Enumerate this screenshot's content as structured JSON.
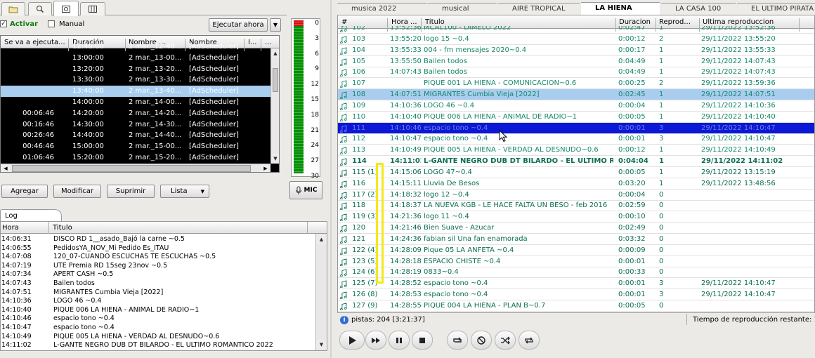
{
  "left": {
    "activar_label": "Activar",
    "manual_label": "Manual",
    "ejecutar_label": "Ejecutar ahora",
    "columns": [
      "Se va a ejecuta...",
      "Duración",
      "Nombre ...",
      "Nombre",
      "I...",
      "..."
    ],
    "rows": [
      {
        "sev": "",
        "dur": "12:40:00",
        "n1": "2 mar._12-40...",
        "n2": "[AdScheduler]"
      },
      {
        "sev": "",
        "dur": "13:00:00",
        "n1": "2 mar._13-00...",
        "n2": "[AdScheduler]"
      },
      {
        "sev": "",
        "dur": "13:20:00",
        "n1": "2 mar._13-20...",
        "n2": "[AdScheduler]"
      },
      {
        "sev": "",
        "dur": "13:30:00",
        "n1": "2 mar._13-30...",
        "n2": "[AdScheduler]"
      },
      {
        "sev": "",
        "dur": "13:40:00",
        "n1": "2 mar._13-40...",
        "n2": "[AdScheduler]",
        "sel": true
      },
      {
        "sev": "",
        "dur": "14:00:00",
        "n1": "2 mar._14-00...",
        "n2": "[AdScheduler]"
      },
      {
        "sev": "00:06:46",
        "dur": "14:20:00",
        "n1": "2 mar._14-20...",
        "n2": "[AdScheduler]"
      },
      {
        "sev": "00:16:46",
        "dur": "14:30:00",
        "n1": "2 mar._14-30...",
        "n2": "[AdScheduler]"
      },
      {
        "sev": "00:26:46",
        "dur": "14:40:00",
        "n1": "2 mar._14-40...",
        "n2": "[AdScheduler]"
      },
      {
        "sev": "00:46:46",
        "dur": "15:00:00",
        "n1": "2 mar._15-00...",
        "n2": "[AdScheduler]"
      },
      {
        "sev": "01:06:46",
        "dur": "15:20:00",
        "n1": "2 mar._15-20...",
        "n2": "[AdScheduler]"
      },
      {
        "sev": "01:16:46",
        "dur": "15:30:00",
        "n1": "2 mar._15-30...",
        "n2": "[AdScheduler]"
      }
    ],
    "buttons": {
      "agregar": "Agregar",
      "modificar": "Modificar",
      "suprimir": "Suprimir",
      "lista": "Lista"
    }
  },
  "meter": {
    "labels": [
      "0",
      "3",
      "6",
      "9",
      "12",
      "15",
      "18",
      "21",
      "24",
      "27",
      "30"
    ],
    "mic_label": "MIC"
  },
  "log": {
    "tab_label": "Log",
    "columns": [
      "Hora",
      "Titulo"
    ],
    "rows": [
      {
        "h": "14:06:31",
        "t": "DISCO RD 1__asado_Bajó la carne ~0.5"
      },
      {
        "h": "14:06:55",
        "t": "PedidosYA_NOV_Mi Pedido Es_ITAU"
      },
      {
        "h": "14:07:08",
        "t": "120_07-CUANDO ESCUCHAS TE ESCUCHAS ~0.5"
      },
      {
        "h": "14:07:19",
        "t": "UTE Premia RD 15seg 23nov ~0.5"
      },
      {
        "h": "14:07:34",
        "t": "APERT CASH ~0.5"
      },
      {
        "h": "14:07:43",
        "t": "Bailen todos"
      },
      {
        "h": "14:07:51",
        "t": "MIGRANTES  Cumbia Vieja [2022]"
      },
      {
        "h": "14:10:36",
        "t": "LOGO 46 ~0.4"
      },
      {
        "h": "14:10:40",
        "t": "PIQUE 006 LA HIENA - ANIMAL DE RADIO~1"
      },
      {
        "h": "14:10:46",
        "t": "espacio tono ~0.4"
      },
      {
        "h": "14:10:47",
        "t": "espacio tono ~0.4"
      },
      {
        "h": "14:10:49",
        "t": "PIQUE 005 LA HIENA - VERDAD AL DESNUDO~0.6"
      },
      {
        "h": "14:11:02",
        "t": "L-GANTE NEGRO DUB DT BILARDO - EL ÚLTIMO ROMÁNTICO 2022"
      }
    ]
  },
  "playlist": {
    "tabs": [
      "musica 2022",
      "musical",
      "AIRE TROPICAL",
      "LA  HIENA",
      "LA CASA 100",
      "EL ULTIMO PIRATA"
    ],
    "active_tab": 3,
    "columns": [
      "#",
      "Hora ...",
      "Titulo",
      "Duracion",
      "Reprod...",
      "Ultima reproduccion"
    ],
    "rows": [
      {
        "n": "102",
        "h": "13:52:36",
        "t": "MCAL100 - DIMELO 2022",
        "d": "0:02:47",
        "r": "1",
        "u": "29/11/2022 13:52:36"
      },
      {
        "n": "103",
        "h": "13:55:20",
        "t": "logo 15 ~0.4",
        "d": "0:00:12",
        "r": "2",
        "u": "29/11/2022 13:55:20"
      },
      {
        "n": "104",
        "h": "13:55:33",
        "t": "004 - fm mensajes 2020~0.4",
        "d": "0:00:17",
        "r": "1",
        "u": "29/11/2022 13:55:33"
      },
      {
        "n": "105",
        "h": "13:55:50",
        "t": "Bailen todos",
        "d": "0:04:49",
        "r": "1",
        "u": "29/11/2022 14:07:43"
      },
      {
        "n": "106",
        "h": "14:07:43",
        "t": "Bailen todos",
        "d": "0:04:49",
        "r": "1",
        "u": "29/11/2022 14:07:43"
      },
      {
        "n": "107",
        "h": "",
        "t": "PIQUE 001 LA HIENA - COMUNICACION~0.6",
        "d": "0:00:25",
        "r": "2",
        "u": "29/11/2022 13:59:36"
      },
      {
        "n": "108",
        "h": "14:07:51",
        "t": "MIGRANTES  Cumbia Vieja [2022]",
        "d": "0:02:45",
        "r": "1",
        "u": "29/11/2022 14:07:51",
        "cls": "hl"
      },
      {
        "n": "109",
        "h": "14:10:36",
        "t": "LOGO 46 ~0.4",
        "d": "0:00:04",
        "r": "1",
        "u": "29/11/2022 14:10:36"
      },
      {
        "n": "110",
        "h": "14:10:40",
        "t": "PIQUE 006 LA HIENA - ANIMAL DE RADIO~1",
        "d": "0:00:05",
        "r": "1",
        "u": "29/11/2022 14:10:40"
      },
      {
        "n": "111",
        "h": "14:10:46",
        "t": "espacio tono ~0.4",
        "d": "0:00:01",
        "r": "3",
        "u": "29/11/2022 14:10:47",
        "cls": "cur"
      },
      {
        "n": "112",
        "h": "14:10:47",
        "t": "espacio tono ~0.4",
        "d": "0:00:01",
        "r": "3",
        "u": "29/11/2022 14:10:47"
      },
      {
        "n": "113",
        "h": "14:10:49",
        "t": "PIQUE 005 LA HIENA - VERDAD AL DESNUDO~0.6",
        "d": "0:00:12",
        "r": "1",
        "u": "29/11/2022 14:10:49"
      },
      {
        "n": "114",
        "h": "14:11:02",
        "t": "L-GANTE NEGRO DUB DT BILARDO - EL ÚLTIMO RO",
        "d": "0:04:04",
        "r": "1",
        "u": "29/11/2022 14:11:02",
        "cls": "bold"
      },
      {
        "n": "115 (1)",
        "h": "14:15:06",
        "t": "LOGO 47~0.4",
        "d": "0:00:05",
        "r": "1",
        "u": "29/11/2022 13:15:19",
        "cls": "pend"
      },
      {
        "n": "116",
        "h": "14:15:11",
        "t": "Lluvia De Besos",
        "d": "0:03:20",
        "r": "1",
        "u": "29/11/2022 13:48:56",
        "cls": "pend"
      },
      {
        "n": "117 (2)",
        "h": "14:18:32",
        "t": "logo 12 ~0.4",
        "d": "0:00:04",
        "r": "0",
        "u": "",
        "cls": "pend"
      },
      {
        "n": "118",
        "h": "14:18:37",
        "t": "LA NUEVA KGB - LE HACE FALTA UN BESO - feb 2016",
        "d": "0:02:59",
        "r": "0",
        "u": "",
        "cls": "pend"
      },
      {
        "n": "119 (3)",
        "h": "14:21:36",
        "t": "logo 11 ~0.4",
        "d": "0:00:10",
        "r": "0",
        "u": "",
        "cls": "pend"
      },
      {
        "n": "120",
        "h": "14:21:46",
        "t": "Bien Suave - Azucar",
        "d": "0:02:49",
        "r": "0",
        "u": "",
        "cls": "pend"
      },
      {
        "n": "121",
        "h": "14:24:36",
        "t": "fabian sil Una fan enamorada",
        "d": "0:03:32",
        "r": "0",
        "u": "",
        "cls": "pend"
      },
      {
        "n": "122 (4)",
        "h": "14:28:09",
        "t": "Pique 05 LA ANFETA ~0.4",
        "d": "0:00:09",
        "r": "0",
        "u": "",
        "cls": "pend"
      },
      {
        "n": "123 (5)",
        "h": "14:28:18",
        "t": "ESPACIO CHISTE ~0.4",
        "d": "0:00:01",
        "r": "0",
        "u": "",
        "cls": "pend"
      },
      {
        "n": "124 (6)",
        "h": "14:28:19",
        "t": "0833~0.4",
        "d": "0:00:33",
        "r": "0",
        "u": "",
        "cls": "pend"
      },
      {
        "n": "125 (7)",
        "h": "14:28:52",
        "t": "espacio tono ~0.4",
        "d": "0:00:01",
        "r": "3",
        "u": "29/11/2022 14:10:47",
        "cls": "pend"
      },
      {
        "n": "126 (8)",
        "h": "14:28:53",
        "t": "espacio tono ~0.4",
        "d": "0:00:01",
        "r": "3",
        "u": "29/11/2022 14:10:47",
        "cls": "pend"
      },
      {
        "n": "127 (9)",
        "h": "14:28:55",
        "t": "PIQUE 004 LA HIENA - PLAN B~0.7",
        "d": "0:00:05",
        "r": "0",
        "u": "",
        "cls": "pend"
      }
    ],
    "status_left": "pistas: 204 [3:21:37]",
    "status_right": "Tiempo de reproducción restante: 1"
  },
  "colors": {
    "accent_green": "#16876a",
    "selection": "#a9cdef",
    "current": "#0b18d6",
    "highlight_box": "#f2ea1a"
  }
}
